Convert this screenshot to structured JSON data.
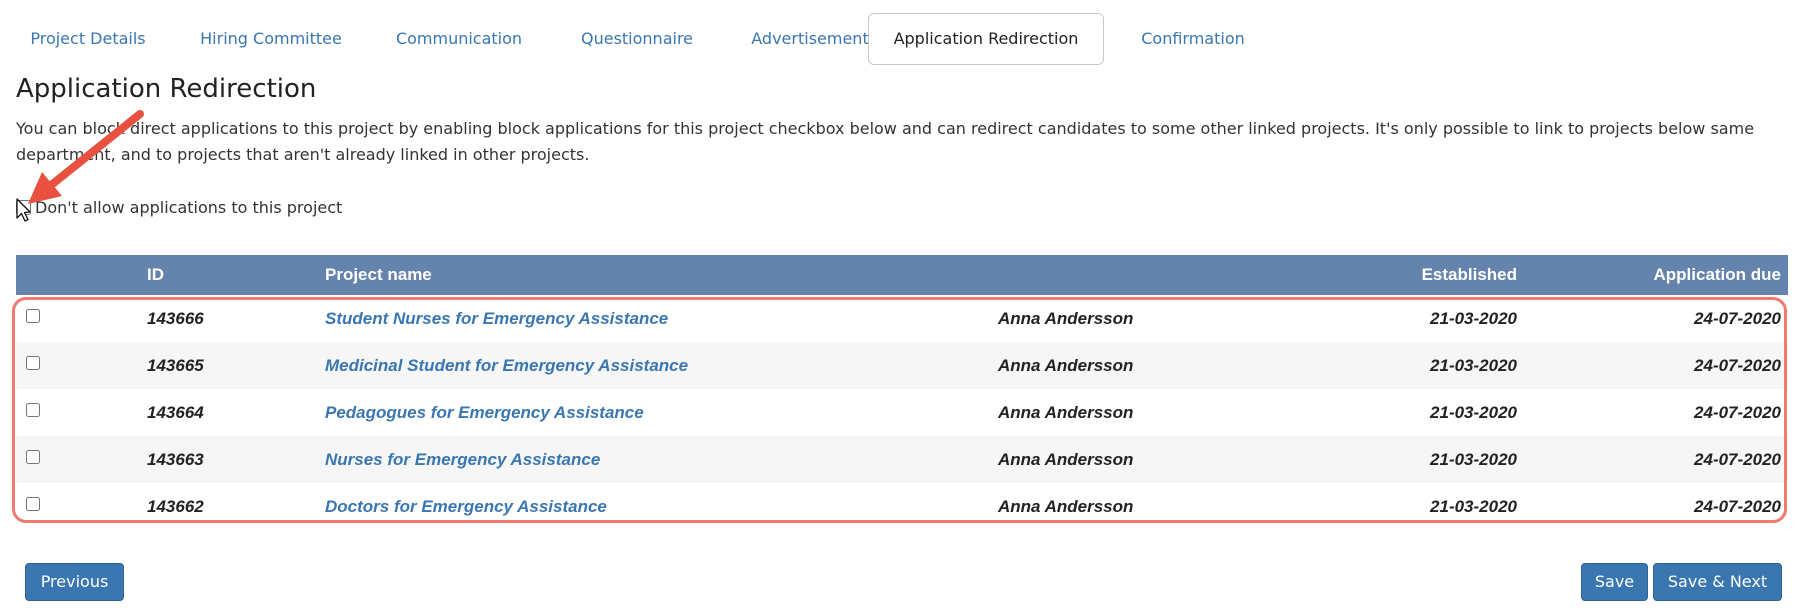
{
  "tabs": [
    {
      "label": "Project Details"
    },
    {
      "label": "Hiring Committee"
    },
    {
      "label": "Communication"
    },
    {
      "label": "Questionnaire"
    },
    {
      "label": "Advertisement"
    },
    {
      "label": "Application Redirection"
    },
    {
      "label": "Confirmation"
    }
  ],
  "page": {
    "title": "Application Redirection",
    "description": "You can block direct applications to this project by enabling block applications for this project checkbox below and can redirect candidates to some other linked projects. It's only possible to link to projects below same department, and to projects that aren't already linked in other projects.",
    "block_label": "Don't allow applications to this project"
  },
  "table": {
    "headers": {
      "id": "ID",
      "name": "Project name",
      "owner": "",
      "established": "Established",
      "due": "Application due"
    },
    "rows": [
      {
        "id": "143666",
        "name": "Student Nurses for Emergency Assistance",
        "owner": "Anna Andersson",
        "established": "21-03-2020",
        "due": "24-07-2020"
      },
      {
        "id": "143665",
        "name": "Medicinal Student for Emergency Assistance",
        "owner": "Anna Andersson",
        "established": "21-03-2020",
        "due": "24-07-2020"
      },
      {
        "id": "143664",
        "name": "Pedagogues for Emergency Assistance",
        "owner": "Anna Andersson",
        "established": "21-03-2020",
        "due": "24-07-2020"
      },
      {
        "id": "143663",
        "name": "Nurses for Emergency Assistance",
        "owner": "Anna Andersson",
        "established": "21-03-2020",
        "due": "24-07-2020"
      },
      {
        "id": "143662",
        "name": "Doctors for Emergency Assistance",
        "owner": "Anna Andersson",
        "established": "21-03-2020",
        "due": "24-07-2020"
      }
    ]
  },
  "buttons": {
    "previous": "Previous",
    "save": "Save",
    "save_next": "Save & Next"
  },
  "colors": {
    "accent": "#3a76b0",
    "table_header": "#6584ad",
    "highlight": "#ee7a70",
    "annotation_arrow": "#e8503f"
  }
}
